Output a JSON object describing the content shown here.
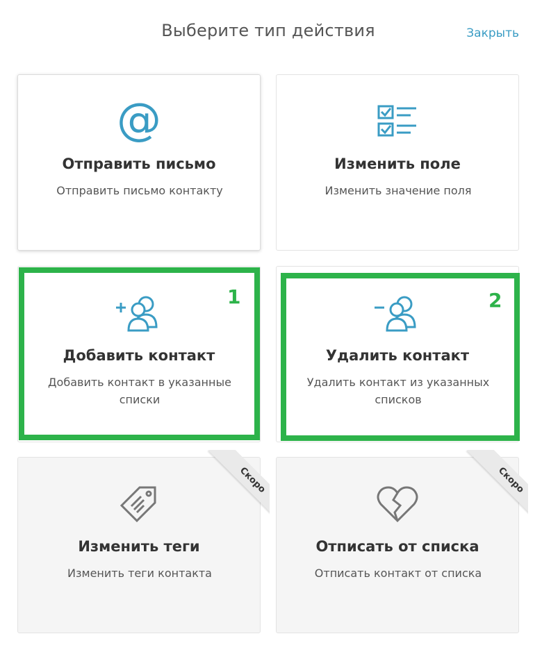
{
  "header": {
    "title": "Выберите тип действия",
    "close_label": "Закрыть"
  },
  "cards": [
    {
      "title": "Отправить письмо",
      "description": "Отправить письмо контакту",
      "icon": "at-icon"
    },
    {
      "title": "Изменить поле",
      "description": "Изменить значение поля",
      "icon": "checklist-icon"
    },
    {
      "title": "Добавить контакт",
      "description": "Добавить контакт в указанные списки",
      "icon": "add-users-icon"
    },
    {
      "title": "Удалить контакт",
      "description": "Удалить контакт из указанных списков",
      "icon": "remove-users-icon"
    },
    {
      "title": "Изменить теги",
      "description": "Изменить теги контакта",
      "icon": "tag-icon",
      "ribbon": "Скоро"
    },
    {
      "title": "Отписать от списка",
      "description": "Отписать контакт от списка",
      "icon": "broken-heart-icon",
      "ribbon": "Скоро"
    }
  ],
  "annotations": [
    {
      "label": "1"
    },
    {
      "label": "2"
    }
  ],
  "colors": {
    "accent": "#3a9cc4",
    "highlight": "#2db34a",
    "disabled_icon": "#777777"
  }
}
